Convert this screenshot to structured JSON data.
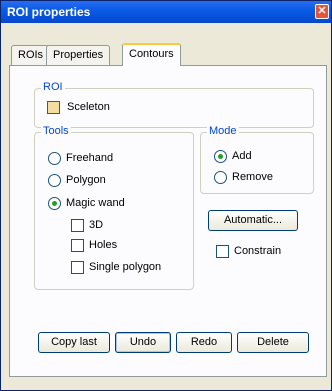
{
  "window": {
    "title": "ROI properties",
    "close_glyph": "✕"
  },
  "tabs": [
    {
      "label": "ROIs"
    },
    {
      "label": "Properties"
    },
    {
      "label": "Contours",
      "active": true
    }
  ],
  "roi_group": {
    "label": "ROI",
    "name": "Sceleton",
    "swatch_color": "#f5dca0"
  },
  "tools_group": {
    "label": "Tools",
    "options": [
      {
        "label": "Freehand",
        "checked": false
      },
      {
        "label": "Polygon",
        "checked": false
      },
      {
        "label": "Magic wand",
        "checked": true
      }
    ],
    "sub_options": [
      {
        "label": "3D",
        "checked": false
      },
      {
        "label": "Holes",
        "checked": false
      },
      {
        "label": "Single polygon",
        "checked": false
      }
    ]
  },
  "mode_group": {
    "label": "Mode",
    "options": [
      {
        "label": "Add",
        "checked": true
      },
      {
        "label": "Remove",
        "checked": false
      }
    ]
  },
  "automatic_button": "Automatic...",
  "constrain": {
    "label": "Constrain",
    "checked": false
  },
  "buttons": {
    "copy_last": "Copy last",
    "undo": "Undo",
    "redo": "Redo",
    "delete": "Delete"
  }
}
